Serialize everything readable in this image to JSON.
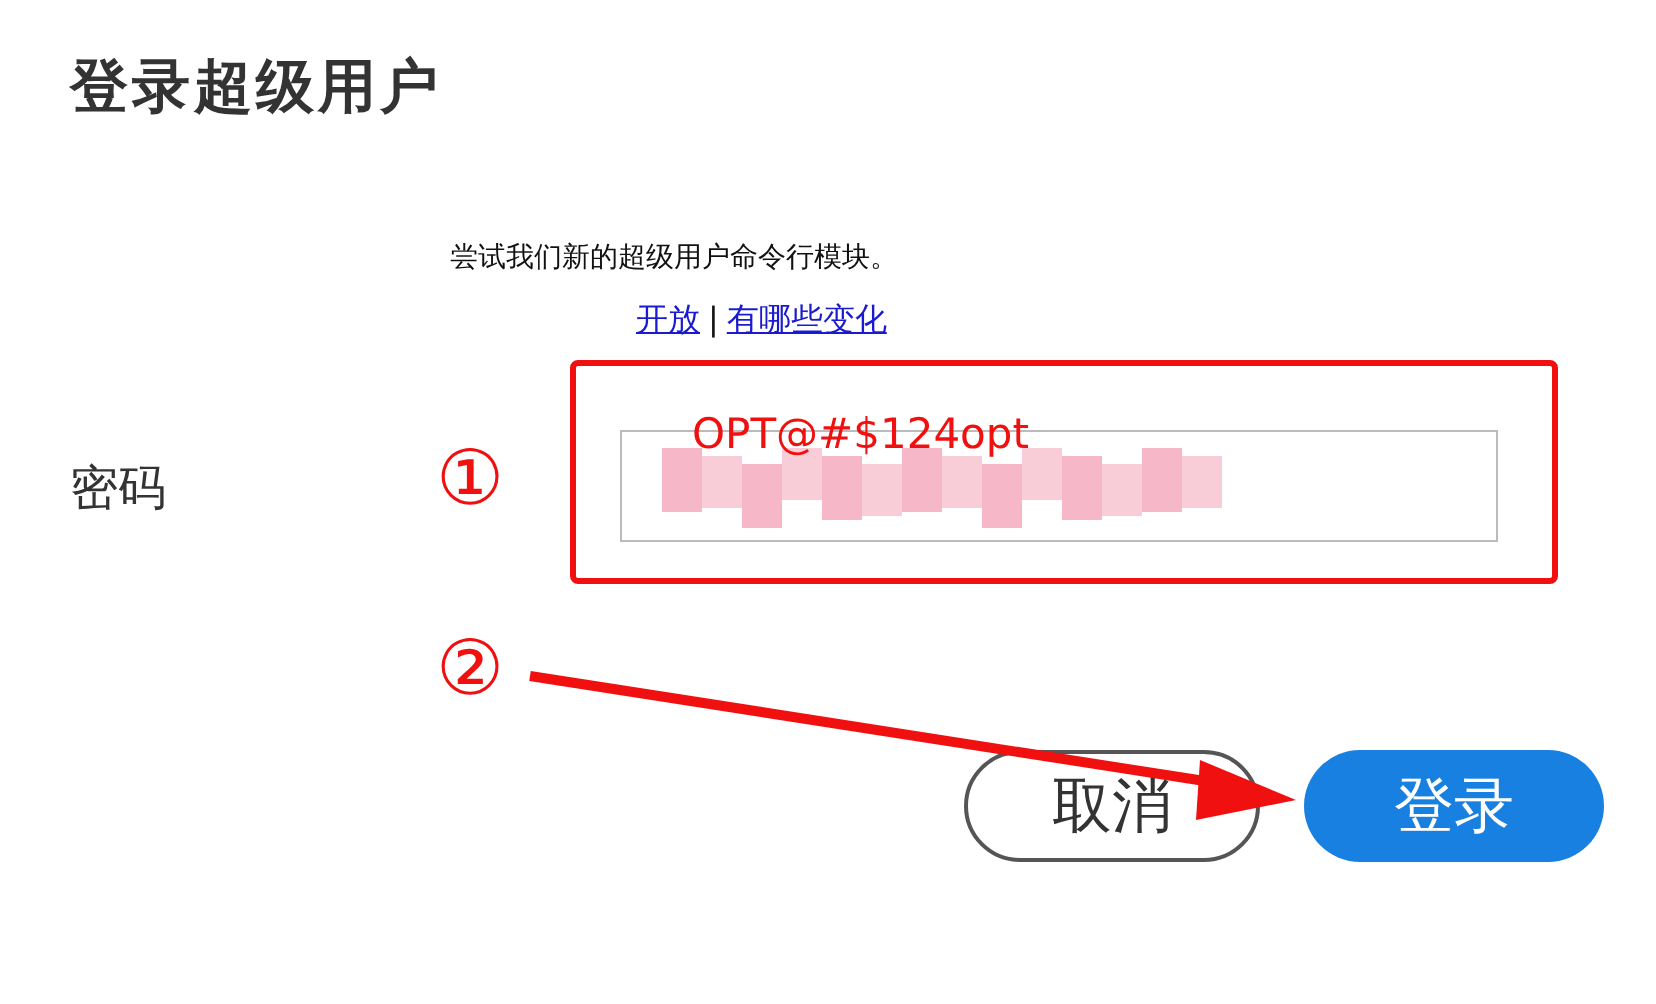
{
  "title": "登录超级用户",
  "notice": "尝试我们新的超级用户命令行模块。",
  "links": [
    {
      "label": "开放"
    },
    {
      "label": "有哪些变化"
    }
  ],
  "link_separator": "|",
  "password": {
    "label": "密码"
  },
  "annotations": {
    "steps": [
      "①",
      "②"
    ],
    "password_hint": "OPT@#$124opt"
  },
  "buttons": [
    {
      "label": "取消",
      "kind": "secondary"
    },
    {
      "label": "登录",
      "kind": "primary"
    }
  ]
}
